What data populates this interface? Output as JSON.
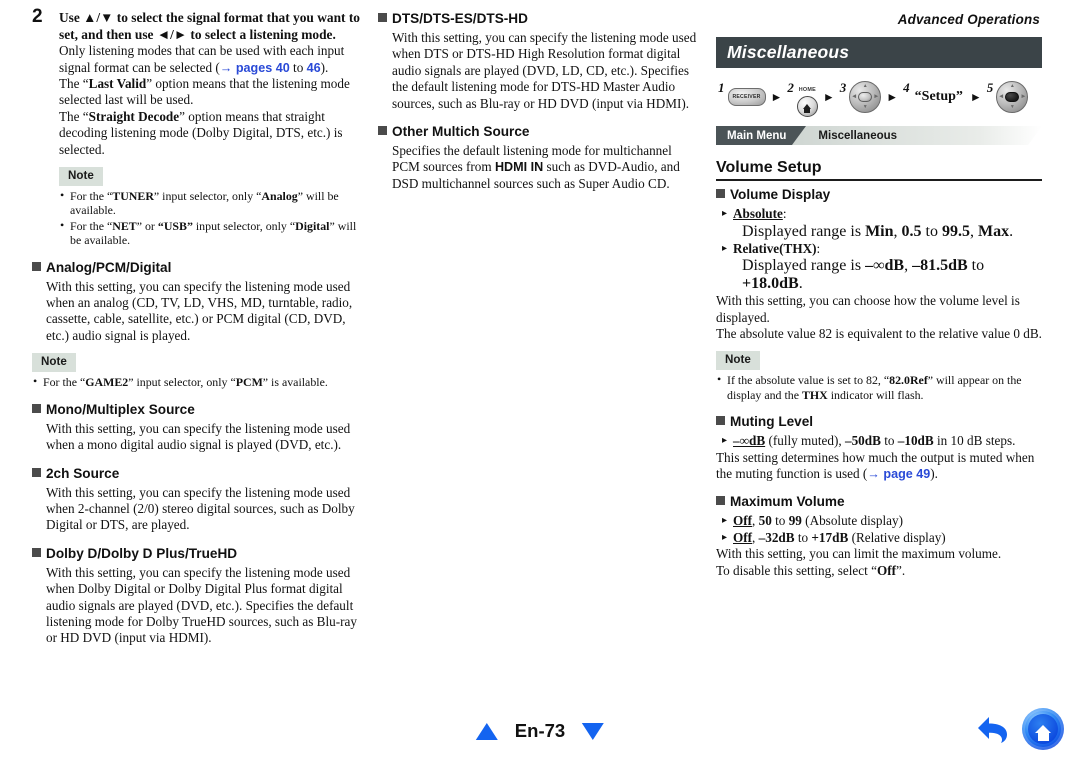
{
  "header": {
    "running_head": "Advanced Operations"
  },
  "footer": {
    "page_label": "En-73",
    "prev_icon": "triangle-up-icon",
    "next_icon": "triangle-down-icon",
    "back_icon": "back-arrow-icon",
    "home_icon": "home-icon"
  },
  "column1": {
    "step": {
      "number": "2",
      "lead_1": "Use ▲/▼ to select the signal format that you want to",
      "lead_2": "set, and then use ◄/► to select a listening mode.",
      "para1_a": "Only listening modes that can be used with each input signal format can be selected (",
      "para1_link_arrow": "→",
      "para1_link_pages": "pages 40",
      "para1_link_to": " to ",
      "para1_link_46": "46",
      "para1_b": ").",
      "para2_a": "The “",
      "para2_bold": "Last Valid",
      "para2_b": "” option means that the listening mode selected last will be used.",
      "para3_a": "The “",
      "para3_bold": "Straight Decode",
      "para3_b": "” option means that straight decoding listening mode (Dolby Digital, DTS, etc.) is selected."
    },
    "note1": {
      "label": "Note",
      "items": [
        "For the “TUNER” input selector, only “Analog” will be available.",
        "For the “NET” or “USB” input selector, only “Digital” will be available."
      ]
    },
    "sections": [
      {
        "title": "Analog/PCM/Digital",
        "body": "With this setting, you can specify the listening mode used when an analog (CD, TV, LD, VHS, MD, turntable, radio, cassette, cable, satellite, etc.) or PCM digital (CD, DVD, etc.) audio signal is played."
      },
      {
        "title": "Mono/Multiplex Source",
        "body": "With this setting, you can specify the listening mode used when a mono digital audio signal is played (DVD, etc.)."
      },
      {
        "title": "2ch Source",
        "body": "With this setting, you can specify the listening mode used when 2-channel (2/0) stereo digital sources, such as Dolby Digital or DTS, are played."
      },
      {
        "title": "Dolby D/Dolby D Plus/TrueHD",
        "body": "With this setting, you can specify the listening mode used when Dolby Digital or Dolby Digital Plus format digital audio signals are played (DVD, etc.). Specifies the default listening mode for Dolby TrueHD sources, such as Blu-ray or HD DVD (input via HDMI)."
      }
    ],
    "note2": {
      "label": "Note",
      "items": [
        "For the “GAME2” input selector, only “PCM” is available."
      ]
    }
  },
  "column2": {
    "sections": [
      {
        "title": "DTS/DTS-ES/DTS-HD",
        "body": "With this setting, you can specify the listening mode used when DTS or DTS-HD High Resolution format digital audio signals are played (DVD, LD, CD, etc.). Specifies the default listening mode for DTS-HD Master Audio sources, such as Blu-ray or HD DVD (input via HDMI)."
      },
      {
        "title": "Other Multich Source",
        "body_a": "Specifies the default listening mode for multichannel PCM sources from ",
        "body_bold": "HDMI IN",
        "body_b": " such as DVD-Audio, and DSD multichannel sources such as Super Audio CD."
      }
    ]
  },
  "column3": {
    "banner_title": "Miscellaneous",
    "remote_steps": [
      {
        "num": "1",
        "icon": "receiver-button-icon",
        "label": "RECEIVER"
      },
      {
        "num": "2",
        "icon": "home-button-icon",
        "label": "HOME"
      },
      {
        "num": "3",
        "icon": "dpad-arrows-icon",
        "label": ""
      },
      {
        "num": "4",
        "icon": "text-label",
        "label": "“Setup”"
      },
      {
        "num": "5",
        "icon": "dpad-enter-icon",
        "label": ""
      }
    ],
    "breadcrumb": {
      "level1": "Main Menu",
      "level2": "Miscellaneous"
    },
    "section_title": "Volume Setup",
    "volume_display": {
      "title": "Volume Display",
      "opt1_name": "Absolute",
      "opt1_colon": ":",
      "opt1_desc_a": "Displayed range is ",
      "opt1_desc_min": "Min",
      "opt1_desc_sep1": ", ",
      "opt1_desc_05": "0.5",
      "opt1_desc_to": " to ",
      "opt1_desc_995": "99.5",
      "opt1_desc_sep2": ", ",
      "opt1_desc_max": "Max",
      "opt1_desc_end": ".",
      "opt2_name": "Relative(THX)",
      "opt2_colon": ":",
      "opt2_desc_a": "Displayed range is ",
      "opt2_desc_inf": "–∞dB",
      "opt2_desc_sep": ", ",
      "opt2_desc_815": "–81.5dB",
      "opt2_desc_to": " to ",
      "opt2_desc_180": "+18.0dB",
      "opt2_desc_end": ".",
      "para1": "With this setting, you can choose how the volume level is displayed.",
      "para2": "The absolute value 82 is equivalent to the relative value 0 dB."
    },
    "note": {
      "label": "Note",
      "item_a": "If the absolute value is set to 82, “",
      "item_bold": "82.0Ref",
      "item_b": "” will appear on the display and the ",
      "item_bold2": "THX",
      "item_c": " indicator will flash."
    },
    "muting_level": {
      "title": "Muting Level",
      "opt_inf": "–∞dB",
      "opt_a": " (fully muted), ",
      "opt_50": "–50dB",
      "opt_to": " to ",
      "opt_10": "–10dB",
      "opt_b": " in 10 dB steps.",
      "para_a": "This setting determines how much the output is muted when the muting function is used (",
      "para_link_arrow": "→",
      "para_link": "page 49",
      "para_b": ")."
    },
    "maximum_volume": {
      "title": "Maximum Volume",
      "opt1_off": "Off",
      "opt1_a": ", ",
      "opt1_50": "50",
      "opt1_to": " to ",
      "opt1_99": "99",
      "opt1_b": " (Absolute display)",
      "opt2_off": "Off",
      "opt2_a": ", ",
      "opt2_32": "–32dB",
      "opt2_to": " to ",
      "opt2_17": "+17dB",
      "opt2_b": " (Relative display)",
      "para1": "With this setting, you can limit the maximum volume.",
      "para2_a": "To disable this setting, select “",
      "para2_bold": "Off",
      "para2_b": "”."
    }
  }
}
